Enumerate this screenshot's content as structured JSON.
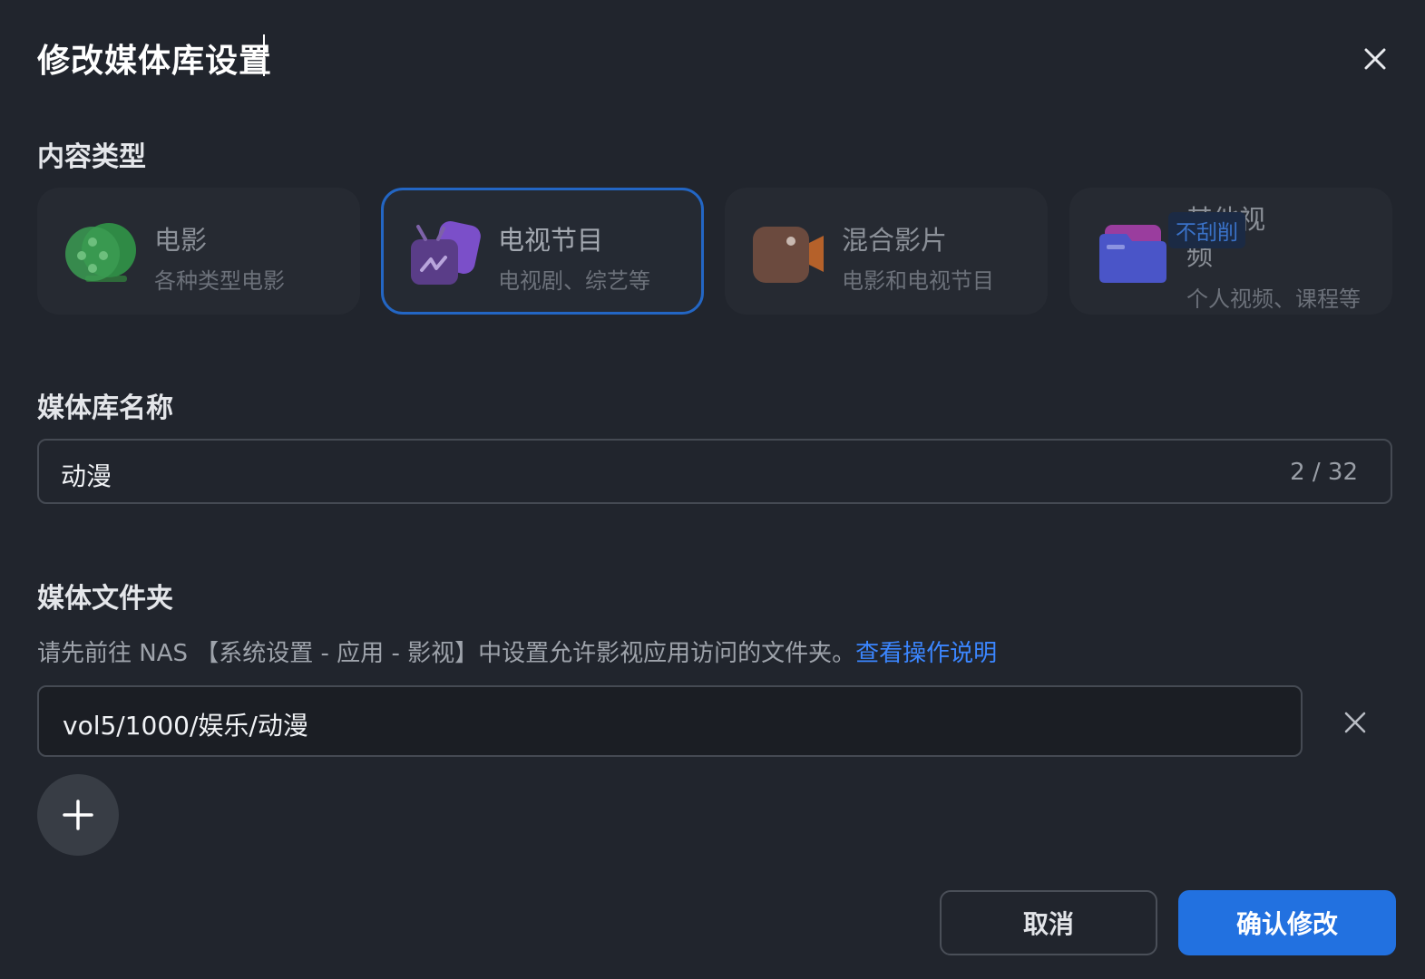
{
  "dialog": {
    "title": "修改媒体库设置"
  },
  "content_type": {
    "label": "内容类型",
    "cards": [
      {
        "title": "电影",
        "subtitle": "各种类型电影",
        "icon": "film-reel-icon",
        "selected": false
      },
      {
        "title": "电视节目",
        "subtitle": "电视剧、综艺等",
        "icon": "tv-icon",
        "selected": true
      },
      {
        "title": "混合影片",
        "subtitle": "电影和电视节目",
        "icon": "camera-icon",
        "selected": false
      },
      {
        "title": "其他视频",
        "subtitle": "个人视频、课程等",
        "icon": "folder-icon",
        "selected": false,
        "badge": "不刮削"
      }
    ]
  },
  "library_name": {
    "label": "媒体库名称",
    "value": "动漫",
    "counter": "2 / 32"
  },
  "media_folder": {
    "label": "媒体文件夹",
    "hint": "请先前往 NAS 【系统设置 - 应用 - 影视】中设置允许影视应用访问的文件夹。",
    "hint_link": "查看操作说明",
    "paths": [
      "vol5/1000/娱乐/动漫"
    ]
  },
  "footer": {
    "cancel_label": "取消",
    "confirm_label": "确认修改"
  },
  "colors": {
    "accent": "#2271e0",
    "link": "#3b86ff",
    "background": "#21252d"
  }
}
